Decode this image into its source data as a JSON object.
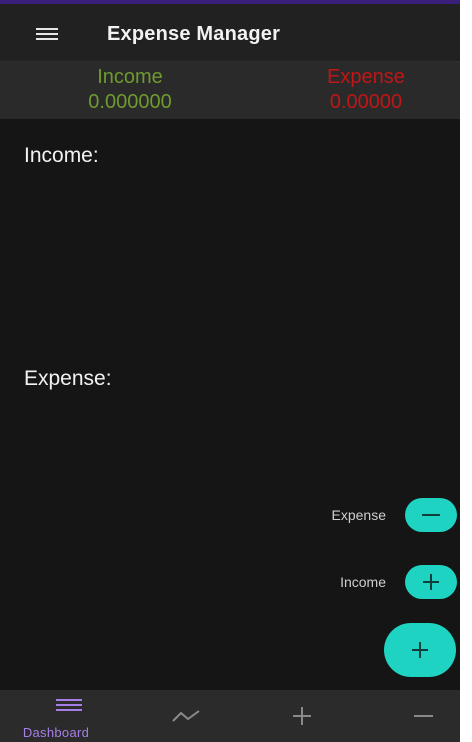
{
  "app_bar": {
    "title": "Expense Manager",
    "menu_icon": "hamburger-menu-icon"
  },
  "summary": {
    "income_label": "Income",
    "income_value": "0.000000",
    "expense_label": "Expense",
    "expense_value": "0.00000",
    "income_color": "#6f9a2e",
    "expense_color": "#c01616"
  },
  "sections": {
    "income_heading": "Income:",
    "expense_heading": "Expense:"
  },
  "fab_menu": {
    "expense_label": "Expense",
    "expense_icon": "minus-icon",
    "income_label": "Income",
    "income_icon": "plus-icon",
    "main_icon": "plus-icon",
    "accent_color": "#1ed3c2"
  },
  "bottom_nav": {
    "items": [
      {
        "label": "Dashboard",
        "icon": "dashboard-lines-icon",
        "active": true
      },
      {
        "label": "",
        "icon": "trend-line-icon",
        "active": false
      },
      {
        "label": "",
        "icon": "plus-icon",
        "active": false
      },
      {
        "label": "",
        "icon": "minus-icon",
        "active": false
      }
    ],
    "active_color": "#a77ee8"
  }
}
